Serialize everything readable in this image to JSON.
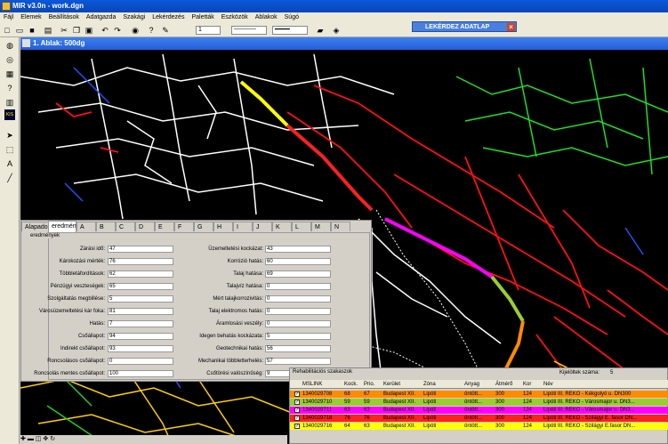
{
  "app": {
    "title": "MIR v3.0n - work.dgn"
  },
  "menu": [
    "Fájl",
    "Elemek",
    "Beállítások",
    "Adatgazda",
    "Szakági",
    "Lekérdezés",
    "Paletták",
    "Eszközök",
    "Ablakok",
    "Súgó"
  ],
  "toolbar": {
    "level": "1",
    "help": "?"
  },
  "lekerdez": {
    "title": "LEKÉRDEZ ADATLAP",
    "close": "×"
  },
  "map_window": {
    "title": "1. Ablak: 500dg"
  },
  "left_tools": {
    "gis_badge": "KIS"
  },
  "eval": {
    "tabs": [
      "Alapadok",
      "eredmény",
      "A",
      "B",
      "C",
      "D",
      "E",
      "F",
      "G",
      "H",
      "I",
      "J",
      "K",
      "L",
      "M",
      "N"
    ],
    "group_label": "eredmények",
    "left_fields": [
      {
        "label": "Zárási idő:",
        "value": "47"
      },
      {
        "label": "Károkozási mérték:",
        "value": "76"
      },
      {
        "label": "Többletáfordítások:",
        "value": "62"
      },
      {
        "label": "Pénzügyi veszteségek:",
        "value": "65"
      },
      {
        "label": "Szolgáltatás megbillése:",
        "value": "5"
      },
      {
        "label": "Városüzemeltetési kár foka:",
        "value": "81"
      },
      {
        "label": "Hatás:",
        "value": "7"
      },
      {
        "label": "Csőállapot:",
        "value": "94"
      },
      {
        "label": "Indirekt csőállapot:",
        "value": "93"
      },
      {
        "label": "Roncsolásos csőállapot:",
        "value": "0"
      },
      {
        "label": "Roncsolás mentes csőállapot:",
        "value": "100"
      }
    ],
    "right_fields": [
      {
        "label": "Üzemeltetési kockázat:",
        "value": "43"
      },
      {
        "label": "Korrózió hatás:",
        "value": "60"
      },
      {
        "label": "Talaj hatása:",
        "value": "69"
      },
      {
        "label": "Talajvíz hatása:",
        "value": "0"
      },
      {
        "label": "Mért talajkorrozivitás:",
        "value": "0"
      },
      {
        "label": "Talaj elektromos hatás:",
        "value": "0"
      },
      {
        "label": "Áramlosási veszély:",
        "value": "0"
      },
      {
        "label": "Idegen behatás kockázata:",
        "value": "5"
      },
      {
        "label": "Geotechnikai hatás:",
        "value": "56"
      },
      {
        "label": "Mechanikai többletterhelés:",
        "value": "57"
      },
      {
        "label": "Csőtörési valószínűség:",
        "value": "9"
      }
    ]
  },
  "rehab": {
    "title": "Rehabilitációs szakaszok",
    "count_label": "Kijelöltek száma:",
    "count_value": "5",
    "headers": [
      "MSLINK",
      "Kock.",
      "Prio.",
      "Kerület",
      "Zóna",
      "Anyag",
      "Átmérő",
      "Kor",
      "Név"
    ],
    "rows": [
      {
        "color": "#ff8c00",
        "cells": [
          "1340029708",
          "68",
          "67",
          "Budapest XII.",
          "Lipóti",
          "öntött...",
          "300",
          "124",
          "Lipóti III. REKO - Kékgolyó u. DN300"
        ]
      },
      {
        "color": "#9acd32",
        "cells": [
          "1340029710",
          "59",
          "59",
          "Budapest XII.",
          "Lipóti",
          "öntött...",
          "300",
          "124",
          "Lipóti III. REKO - Városmajor u. DN3..."
        ]
      },
      {
        "color": "#ff00ff",
        "cells": [
          "1340029711",
          "63",
          "63",
          "Budapest XII.",
          "Lipóti",
          "öntött...",
          "300",
          "124",
          "Lipóti III. REKO - Városmajor u. DN3..."
        ]
      },
      {
        "color": "#ff2020",
        "cells": [
          "1340029718",
          "76",
          "76",
          "Budapest XII.",
          "Lipóti",
          "öntött...",
          "300",
          "124",
          "Lipóti III. REKO - Szilágyi E. fasor DN..."
        ]
      },
      {
        "color": "#ffff00",
        "cells": [
          "1340029716",
          "64",
          "63",
          "Budapest XII.",
          "Lipóti",
          "öntött...",
          "300",
          "124",
          "Lipóti III. REKO - Szilágyi E.fasor DN..."
        ]
      }
    ]
  }
}
